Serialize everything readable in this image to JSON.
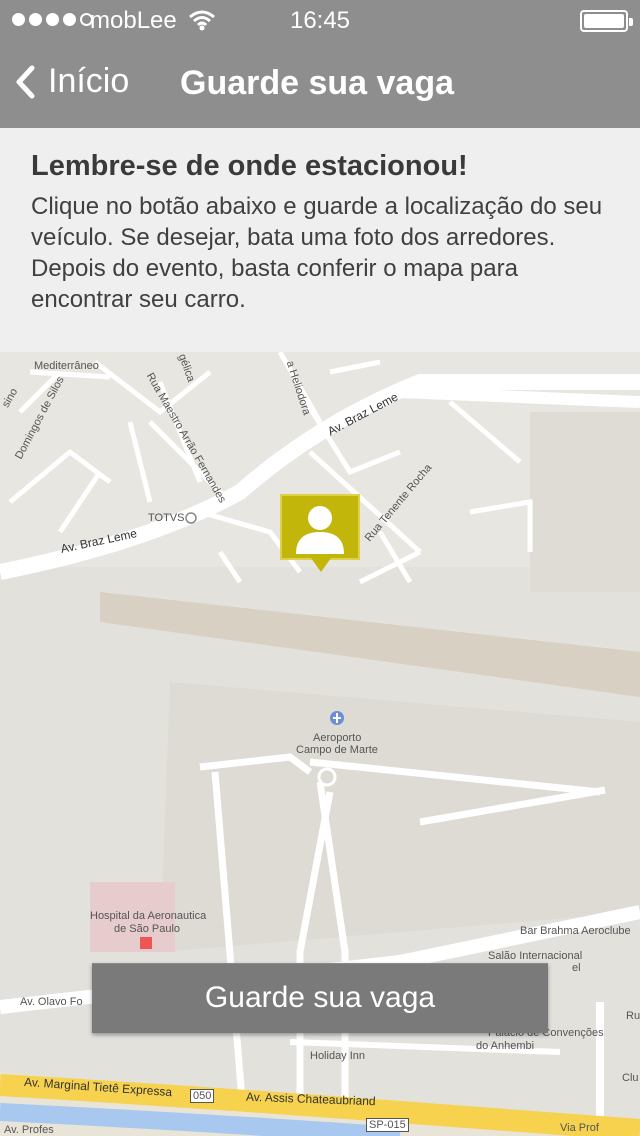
{
  "status_bar": {
    "carrier": "mobLee",
    "time": "16:45",
    "signal_bars": 4,
    "battery_level": 1.0
  },
  "nav": {
    "back_label": "Início",
    "title": "Guarde sua vaga"
  },
  "info": {
    "title": "Lembre-se de onde estacionou!",
    "text": "Clique no botão abaixo e guarde a localização do seu veículo. Se desejar, bata uma foto dos arredores. Depois do evento, basta conferir o mapa para encontrar seu carro."
  },
  "map": {
    "labels": {
      "mediterraneo": "Mediterrâneo",
      "angelica": "gélica",
      "heliodora": "a Heliodora",
      "domingos": "Domingos de Silos",
      "sino": "sino",
      "maestro": "Rua Maestro Arrão Fernandes",
      "braz_leme_1": "Av. Braz Leme",
      "braz_leme_2": "Av. Braz Leme",
      "totvs": "TOTVS",
      "tenente_rocha": "Rua Tenente Rocha",
      "aeroporto": "Aeroporto",
      "campo_de_marte": "Campo de Marte",
      "hospital_1": "Hospital da Aeronautica",
      "hospital_2": "de São Paulo",
      "bar_brahma": "Bar Brahma Aeroclube",
      "salao_1": "Salão Internacional",
      "salao_2": "el",
      "olavo": "Av. Olavo Fo",
      "palacio": "Palácio de Convenções",
      "anhembi": "do Anhembi",
      "holiday": "Holiday Inn",
      "marginal": "Av. Marginal Tietê Expressa",
      "route_050": "050",
      "assis": "Av. Assis Chateaubriand",
      "sp015": "SP-015",
      "via_prof": "Via Prof",
      "av_profes": "Av. Profes",
      "clu": "Clu",
      "ru": "Ru"
    }
  },
  "action": {
    "save_label": "Guarde sua vaga"
  },
  "colors": {
    "bar_bg": "#8e8e8e",
    "marker": "#c2b60a",
    "button_bg": "#7a7a7a",
    "highway": "#f6d24f"
  }
}
